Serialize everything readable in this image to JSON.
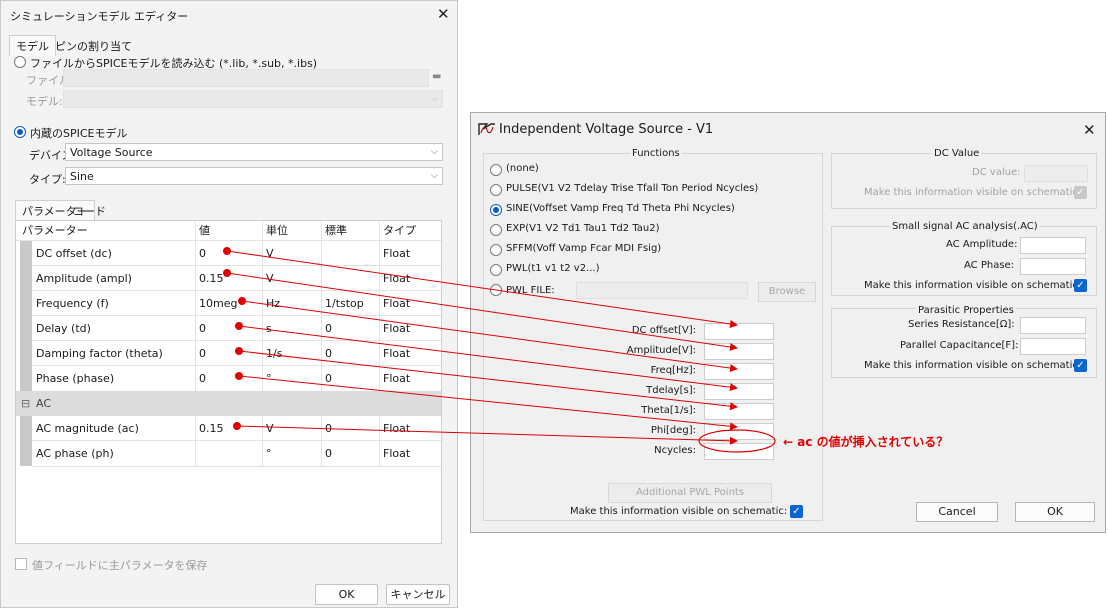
{
  "left_dialog": {
    "title": "シミュレーションモデル エディター",
    "tabs": [
      "モデル",
      "ピンの割り当て"
    ],
    "load_from_file": "ファイルからSPICEモデルを読み込む (*.lib, *.sub, *.ibs)",
    "file_label": "ファイル:",
    "model_label": "モデル:",
    "builtin_model": "内蔵のSPICEモデル",
    "device_label": "デバイス:",
    "device_value": "Voltage Source",
    "type_label": "タイプ:",
    "type_value": "Sine",
    "subtabs": [
      "パラメーター",
      "コード"
    ],
    "columns": [
      "パラメーター",
      "値",
      "単位",
      "標準",
      "タイプ"
    ],
    "rows": [
      {
        "name": "DC offset (dc)",
        "value": "0",
        "unit": "V",
        "std": "",
        "type": "Float"
      },
      {
        "name": "Amplitude (ampl)",
        "value": "0.15",
        "unit": "V",
        "std": "",
        "type": "Float"
      },
      {
        "name": "Frequency (f)",
        "value": "10meg",
        "unit": "Hz",
        "std": "1/tstop",
        "type": "Float"
      },
      {
        "name": "Delay (td)",
        "value": "0",
        "unit": "s",
        "std": "0",
        "type": "Float"
      },
      {
        "name": "Damping factor (theta)",
        "value": "0",
        "unit": "1/s",
        "std": "0",
        "type": "Float"
      },
      {
        "name": "Phase (phase)",
        "value": "0",
        "unit": "°",
        "std": "0",
        "type": "Float"
      }
    ],
    "ac_group": "AC",
    "ac_rows": [
      {
        "name": "AC magnitude (ac)",
        "value": "0.15",
        "unit": "V",
        "std": "0",
        "type": "Float"
      },
      {
        "name": "AC phase (ph)",
        "value": "",
        "unit": "°",
        "std": "0",
        "type": "Float"
      }
    ],
    "save_checkbox": "値フィールドに主パラメータを保存",
    "ok": "OK",
    "cancel": "キャンセル",
    "folder_icon": "folder-icon",
    "close_icon": "close-icon"
  },
  "right_dialog": {
    "title": "Independent Voltage Source - V1",
    "functions_title": "Functions",
    "functions": [
      {
        "label": "(none)",
        "selected": false
      },
      {
        "label": "PULSE(V1 V2 Tdelay Trise Tfall Ton Period Ncycles)",
        "selected": false
      },
      {
        "label": "SINE(Voffset Vamp Freq Td Theta Phi Ncycles)",
        "selected": true
      },
      {
        "label": "EXP(V1 V2 Td1 Tau1 Td2 Tau2)",
        "selected": false
      },
      {
        "label": "SFFM(Voff Vamp Fcar MDI Fsig)",
        "selected": false
      },
      {
        "label": "PWL(t1 v1 t2 v2...)",
        "selected": false
      },
      {
        "label": "PWL FILE:",
        "selected": false
      }
    ],
    "browse": "Browse",
    "sine_params": [
      "DC offset[V]:",
      "Amplitude[V]:",
      "Freq[Hz]:",
      "Tdelay[s]:",
      "Theta[1/s]:",
      "Phi[deg]:",
      "Ncycles:"
    ],
    "additional_pwl": "Additional PWL Points",
    "make_visible": "Make this information visible on schematic:",
    "dc_value_title": "DC Value",
    "dc_value_label": "DC value:",
    "ac_title": "Small signal AC analysis(.AC)",
    "ac_amplitude": "AC Amplitude:",
    "ac_phase": "AC Phase:",
    "parasitic_title": "Parasitic Properties",
    "series_resistance": "Series Resistance[Ω]:",
    "parallel_capacitance": "Parallel Capacitance[F]:",
    "cancel": "Cancel",
    "ok": "OK",
    "app_icon": "ltspice-probe-icon",
    "close_icon": "close-icon"
  },
  "annotation": {
    "text": "← ac の値が挿入されている？",
    "color": "#e00000"
  }
}
